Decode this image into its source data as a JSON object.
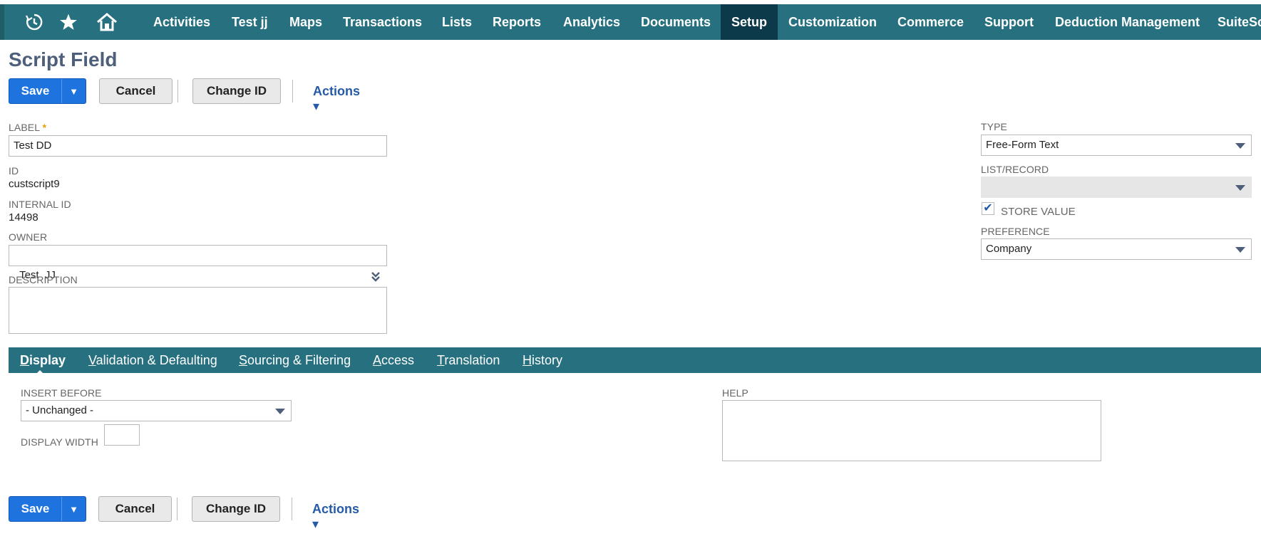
{
  "nav": {
    "items": [
      "Activities",
      "Test jj",
      "Maps",
      "Transactions",
      "Lists",
      "Reports",
      "Analytics",
      "Documents",
      "Setup",
      "Customization",
      "Commerce",
      "Support",
      "Deduction Management",
      "SuiteSc"
    ],
    "active": "Setup",
    "icons": [
      "recent-icon",
      "star-icon",
      "home-icon"
    ]
  },
  "page": {
    "title": "Script Field"
  },
  "buttons": {
    "save": "Save",
    "save_arrow": "▼",
    "cancel": "Cancel",
    "change_id": "Change ID",
    "actions": "Actions ▾"
  },
  "form": {
    "label": {
      "label": "LABEL",
      "required": "*",
      "value": "Test DD"
    },
    "id": {
      "label": "ID",
      "value": "custscript9"
    },
    "internal_id": {
      "label": "INTERNAL ID",
      "value": "14498"
    },
    "owner": {
      "label": "OWNER",
      "value": "Test  JJ"
    },
    "description": {
      "label": "DESCRIPTION",
      "value": ""
    },
    "type": {
      "label": "TYPE",
      "value": "Free-Form Text"
    },
    "list_record": {
      "label": "LIST/RECORD",
      "value": ""
    },
    "store_value": {
      "label": "STORE VALUE",
      "checked": true,
      "mark": "✔"
    },
    "preference": {
      "label": "PREFERENCE",
      "value": "Company"
    }
  },
  "tabs": [
    {
      "key": "D",
      "rest": "isplay",
      "active": true
    },
    {
      "key": "V",
      "rest": "alidation & Defaulting"
    },
    {
      "key": "S",
      "rest": "ourcing & Filtering"
    },
    {
      "key": "A",
      "rest": "ccess"
    },
    {
      "key": "T",
      "rest": "ranslation"
    },
    {
      "key": "H",
      "rest": "istory"
    }
  ],
  "display_tab": {
    "insert_before": {
      "label": "INSERT BEFORE",
      "value": "- Unchanged -"
    },
    "display_width": {
      "label": "DISPLAY WIDTH",
      "value": ""
    },
    "help": {
      "label": "HELP",
      "value": ""
    }
  }
}
